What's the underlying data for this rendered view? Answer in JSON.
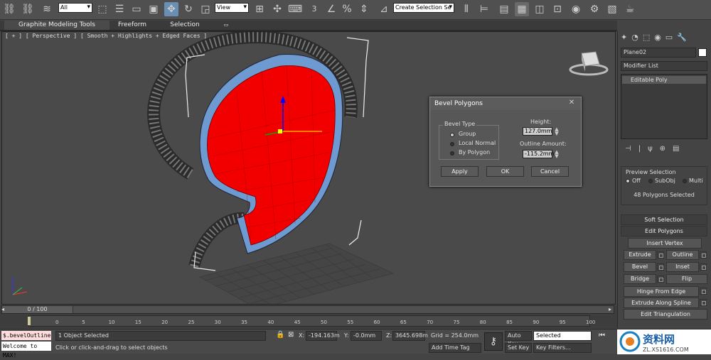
{
  "toolbar": {
    "selection_filter": "All",
    "reference_coord": "View",
    "named_selection_placeholder": "Create Selection Se",
    "snap_label": "3"
  },
  "ribbon": {
    "tabs": [
      "Graphite Modeling Tools",
      "Freeform",
      "Selection"
    ]
  },
  "viewport": {
    "label": "[ + ] [ Perspective ] [ Smooth + Highlights + Edged Faces ]"
  },
  "dialog": {
    "title": "Bevel Polygons",
    "close": "✕",
    "bevel_type_label": "Bevel Type",
    "options": [
      "Group",
      "Local Normal",
      "By Polygon"
    ],
    "selected_option": "Group",
    "height_label": "Height:",
    "height_value": "127.0mm",
    "outline_label": "Outline Amount:",
    "outline_value": "-115.2mm",
    "apply": "Apply",
    "ok": "OK",
    "cancel": "Cancel"
  },
  "command_panel": {
    "object_name": "Plane02",
    "modifier_list": "Modifier List",
    "stack_item": "Editable Poly",
    "preview_selection": "Preview Selection",
    "preview_options": [
      "Off",
      "SubObj",
      "Multi"
    ],
    "polygons_selected": "48 Polygons Selected",
    "soft_selection": "Soft Selection",
    "edit_polygons": "Edit Polygons",
    "insert_vertex": "Insert Vertex",
    "extrude": "Extrude",
    "outline": "Outline",
    "bevel": "Bevel",
    "inset": "Inset",
    "bridge": "Bridge",
    "flip": "Flip",
    "hinge_from_edge": "Hinge From Edge",
    "extrude_along_spline": "Extrude Along Spline",
    "edit_triangulation": "Edit Triangulation"
  },
  "timeline": {
    "frame": "0 / 100",
    "ticks": [
      "0",
      "5",
      "10",
      "15",
      "20",
      "25",
      "30",
      "35",
      "40",
      "45",
      "50",
      "55",
      "60",
      "65",
      "70",
      "75",
      "80",
      "85",
      "90",
      "95",
      "100"
    ]
  },
  "status": {
    "maxscript_line1": "$.bevelOutline",
    "maxscript_line2": "Welcome to MAX!",
    "selected_text": "1 Object Selected",
    "prompt_text": "Click or click-and-drag to select objects",
    "x_label": "X:",
    "x_value": "-194.163m",
    "y_label": "Y:",
    "y_value": "-0.0mm",
    "z_label": "Z:",
    "z_value": "3645.698m",
    "grid": "Grid = 254.0mm",
    "add_time_tag": "Add Time Tag",
    "auto_key": "Auto Key",
    "set_key": "Set Key",
    "key_mode": "Selected",
    "key_filters": "Key Filters..."
  },
  "watermark": "资料网 ZL.XS1616.COM"
}
